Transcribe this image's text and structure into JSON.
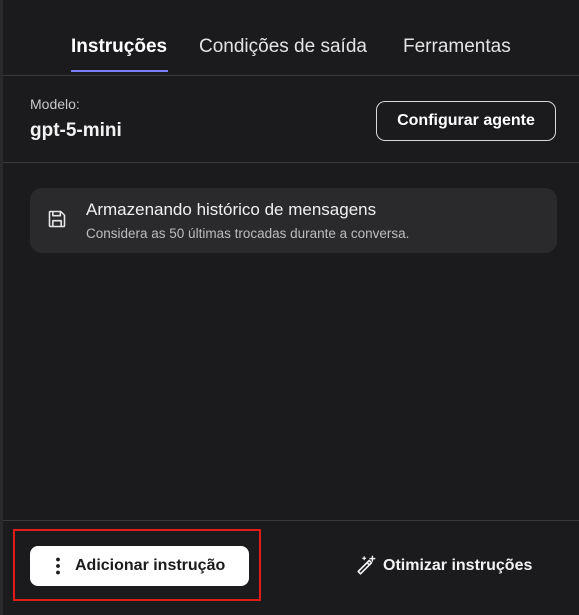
{
  "tabs": [
    {
      "label": "Instruções",
      "active": true
    },
    {
      "label": "Condições de saída",
      "active": false
    },
    {
      "label": "Ferramentas",
      "active": false
    }
  ],
  "model": {
    "label": "Modelo:",
    "value": "gpt-5-mini",
    "configure_button": "Configurar agente"
  },
  "history": {
    "icon": "save-icon",
    "title": "Armazenando histórico de mensagens",
    "description": "Considera as 50 últimas trocadas durante a conversa."
  },
  "footer": {
    "add_button": "Adicionar instrução",
    "add_icon": "more-vertical-icon",
    "optimize_button": "Otimizar instruções",
    "optimize_icon": "magic-wand-icon"
  },
  "colors": {
    "background": "#1b1b1d",
    "card": "#2a2a2d",
    "accent_underline": "#7b7ff3",
    "highlight": "#e21b1b"
  }
}
